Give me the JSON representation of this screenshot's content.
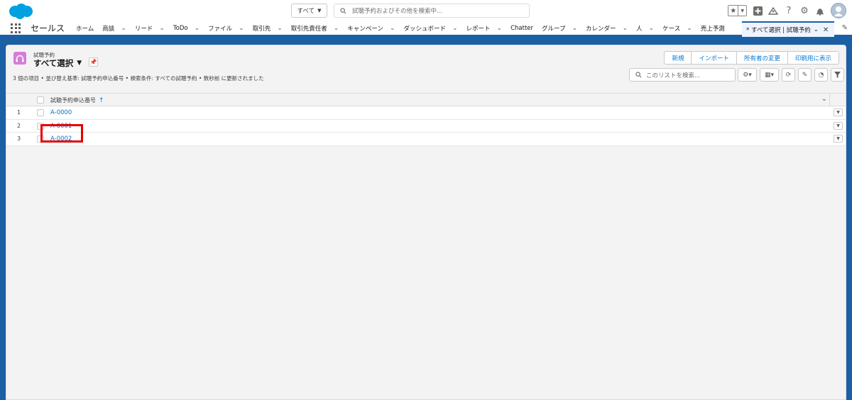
{
  "global_header": {
    "search_scope": "すべて",
    "search_placeholder": "試聴予約およびその他を検索中..."
  },
  "nav": {
    "app_name": "セールス",
    "items": [
      {
        "label": "ホーム",
        "has_menu": false
      },
      {
        "label": "商談",
        "has_menu": true
      },
      {
        "label": "リード",
        "has_menu": true
      },
      {
        "label": "ToDo",
        "has_menu": true
      },
      {
        "label": "ファイル",
        "has_menu": true
      },
      {
        "label": "取引先",
        "has_menu": true
      },
      {
        "label": "取引先責任者",
        "has_menu": true
      },
      {
        "label": "キャンペーン",
        "has_menu": true
      },
      {
        "label": "ダッシュボード",
        "has_menu": true
      },
      {
        "label": "レポート",
        "has_menu": true
      },
      {
        "label": "Chatter",
        "has_menu": false
      },
      {
        "label": "グループ",
        "has_menu": true
      },
      {
        "label": "カレンダー",
        "has_menu": true
      },
      {
        "label": "人",
        "has_menu": true
      },
      {
        "label": "ケース",
        "has_menu": true
      },
      {
        "label": "売上予測",
        "has_menu": false
      }
    ],
    "active_tab": "* すべて選択 | 試聴予約"
  },
  "list_view": {
    "object_label": "試聴予約",
    "view_name": "すべて選択",
    "buttons": [
      "新規",
      "インポート",
      "所有者の変更",
      "印刷用に表示"
    ],
    "meta": "3 個の項目 • 並び替え基準: 試聴予約申込番号 • 検索条件: すべての試聴予約 • 数秒前 に更新されました",
    "search_placeholder": "このリストを検索...",
    "column_header": "試聴予約申込番号",
    "rows": [
      {
        "num": "1",
        "name": "A-0000"
      },
      {
        "num": "2",
        "name": "A-0001"
      },
      {
        "num": "3",
        "name": "A-0002"
      }
    ]
  },
  "colors": {
    "brand": "#0176d3",
    "header_band": "#1b5fa5",
    "object_icon": "#d47dd8",
    "highlight": "#e50000"
  }
}
